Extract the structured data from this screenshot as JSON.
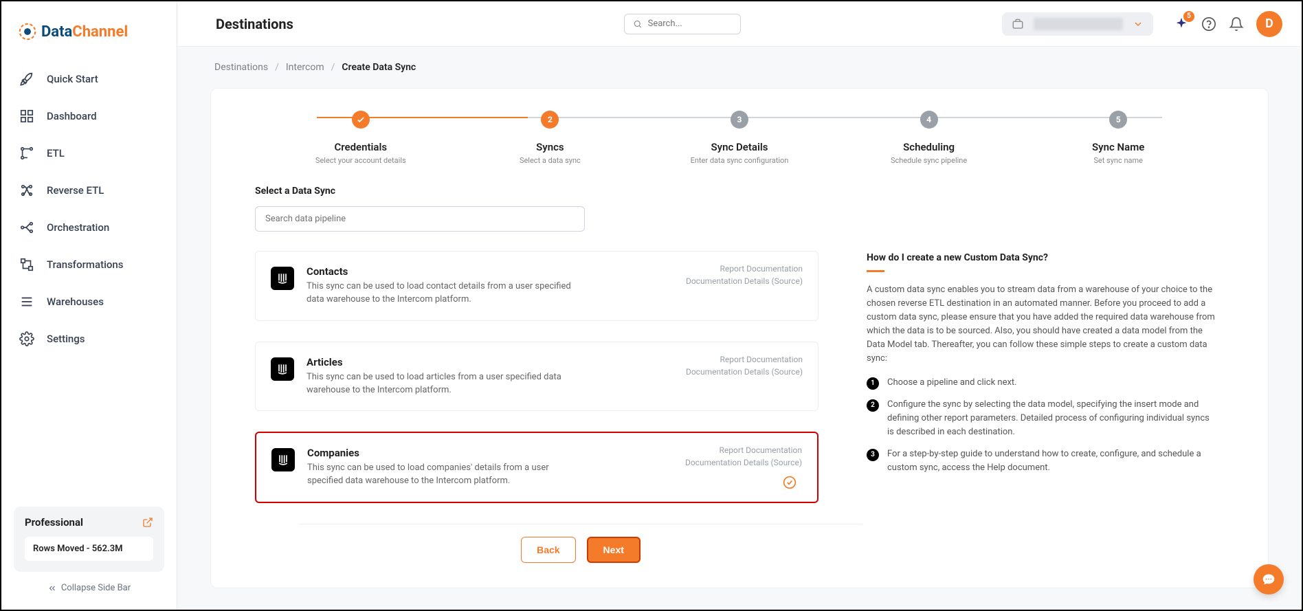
{
  "brand": {
    "part1": "Data",
    "part2": "Channel"
  },
  "sidebar": {
    "items": [
      {
        "label": "Quick Start",
        "icon": "rocket"
      },
      {
        "label": "Dashboard",
        "icon": "grid"
      },
      {
        "label": "ETL",
        "icon": "etl"
      },
      {
        "label": "Reverse ETL",
        "icon": "retl"
      },
      {
        "label": "Orchestration",
        "icon": "orch"
      },
      {
        "label": "Transformations",
        "icon": "trans"
      },
      {
        "label": "Warehouses",
        "icon": "list"
      },
      {
        "label": "Settings",
        "icon": "gear"
      }
    ],
    "plan": {
      "title": "Professional",
      "rows": "Rows Moved - 562.3M"
    },
    "collapse": "Collapse Side Bar"
  },
  "topbar": {
    "title": "Destinations",
    "search_placeholder": "Search...",
    "notif_badge": "5",
    "avatar": "D"
  },
  "breadcrumbs": {
    "a": "Destinations",
    "b": "Intercom",
    "c": "Create Data Sync"
  },
  "stepper": [
    {
      "title": "Credentials",
      "sub": "Select your account details"
    },
    {
      "title": "Syncs",
      "sub": "Select a data sync"
    },
    {
      "title": "Sync Details",
      "sub": "Enter data sync configuration"
    },
    {
      "title": "Scheduling",
      "sub": "Schedule sync pipeline"
    },
    {
      "title": "Sync Name",
      "sub": "Set sync name"
    }
  ],
  "section": {
    "label": "Select a Data Sync",
    "search_placeholder": "Search data pipeline"
  },
  "syncs": [
    {
      "title": "Contacts",
      "desc": "This sync can be used to load contact details from a user specified data warehouse to the Intercom platform.",
      "link1": "Report Documentation",
      "link2": "Documentation Details (Source)"
    },
    {
      "title": "Articles",
      "desc": "This sync can be used to load articles from a user specified data warehouse to the Intercom platform.",
      "link1": "Report Documentation",
      "link2": "Documentation Details (Source)"
    },
    {
      "title": "Companies",
      "desc": "This sync can be used to load companies' details from a user specified data warehouse to the Intercom platform.",
      "link1": "Report Documentation",
      "link2": "Documentation Details (Source)"
    }
  ],
  "help": {
    "title": "How do I create a new Custom Data Sync?",
    "p": "A custom data sync enables you to stream data from a warehouse of your choice to the chosen reverse ETL destination in an automated manner. Before you proceed to add a custom data sync, please ensure that you have added the required data warehouse from which the data is to be sourced. Also, you should have created a data model from the Data Model tab. Thereafter, you can follow these simple steps to create a custom data sync:",
    "steps": [
      "Choose a pipeline and click next.",
      "Configure the sync by selecting the data model, specifying the insert mode and defining other report parameters. Detailed process of configuring individual syncs is described in each destination.",
      "For a step-by-step guide to understand how to create, configure, and schedule a custom sync, access the Help document."
    ]
  },
  "buttons": {
    "back": "Back",
    "next": "Next"
  }
}
